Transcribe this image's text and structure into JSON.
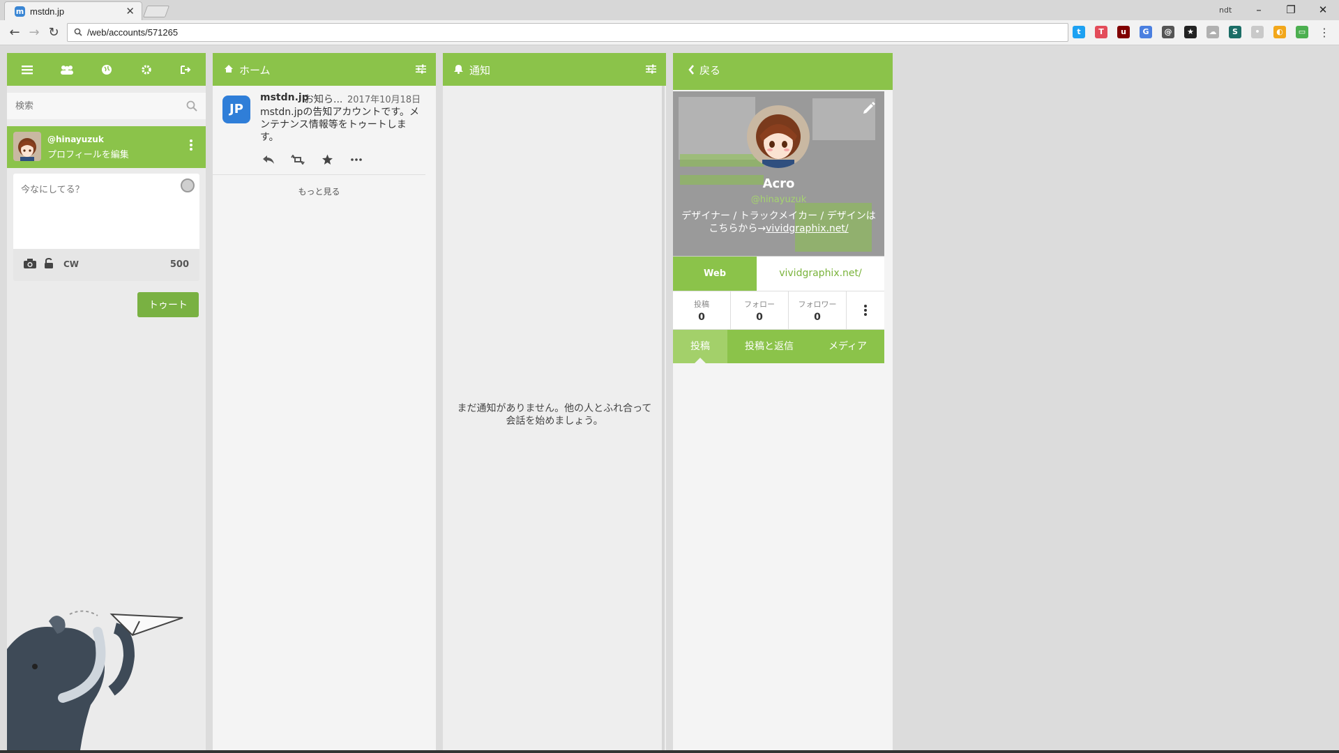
{
  "browser": {
    "tab_title": "mstdn.jp",
    "tab_favicon": "m",
    "user_chip": "ndt",
    "url": "/web/accounts/571265",
    "extensions": [
      {
        "name": "twitter-icon",
        "color": "#1da1f2",
        "glyph": "t"
      },
      {
        "name": "extension-red-icon",
        "color": "#e34c5a",
        "glyph": "T"
      },
      {
        "name": "ublock-icon",
        "color": "#800000",
        "glyph": "u"
      },
      {
        "name": "translate-icon",
        "color": "#4a7fe0",
        "glyph": "G"
      },
      {
        "name": "mail-icon",
        "color": "#555555",
        "glyph": "@"
      },
      {
        "name": "star-ext-icon",
        "color": "#222222",
        "glyph": "★"
      },
      {
        "name": "cloud-icon",
        "color": "#b0b0b0",
        "glyph": "☁"
      },
      {
        "name": "s-ext-icon",
        "color": "#1b6d66",
        "glyph": "S"
      },
      {
        "name": "dot-ext-icon",
        "color": "#c9c9c9",
        "glyph": "•"
      },
      {
        "name": "orange-ext-icon",
        "color": "#f2a71b",
        "glyph": "◐"
      },
      {
        "name": "cast-ext-icon",
        "color": "#4caf50",
        "glyph": "▭"
      }
    ]
  },
  "compose": {
    "search_placeholder": "検索",
    "handle": "@hinayuzuk",
    "edit_profile": "プロフィールを編集",
    "textarea_placeholder": "今なにしてる？",
    "cw_label": "CW",
    "char_count": "500",
    "toot_label": "トゥート"
  },
  "home": {
    "title": "ホーム",
    "status": {
      "avatar_text": "JP",
      "display_name": "mstdn.jp",
      "acct": "お知ら...",
      "date": "2017年10月18日",
      "content": "mstdn.jpの告知アカウントです。メンテナンス情報等をトゥートします。"
    },
    "load_more": "もっと見る"
  },
  "notifications": {
    "title": "通知",
    "empty_message": "まだ通知がありません。他の人とふれ合って会話を始めましょう。"
  },
  "profile": {
    "back_label": "戻る",
    "display_name": "Acro",
    "handle": "@hinayuzuk",
    "note_text": "デザイナー / トラックメイカー / デザインはこちらから→",
    "note_link": "vividgraphix.net/",
    "field_name": "Web",
    "field_value": "vividgraphix.net/",
    "stats": [
      {
        "label": "投稿",
        "value": "0"
      },
      {
        "label": "フォロー",
        "value": "0"
      },
      {
        "label": "フォロワー",
        "value": "0"
      }
    ],
    "tabs": [
      "投稿",
      "投稿と返信",
      "メディア"
    ]
  },
  "colors": {
    "accent": "#8bc34a",
    "toot_button": "#79b142",
    "link": "#7ab33b"
  }
}
